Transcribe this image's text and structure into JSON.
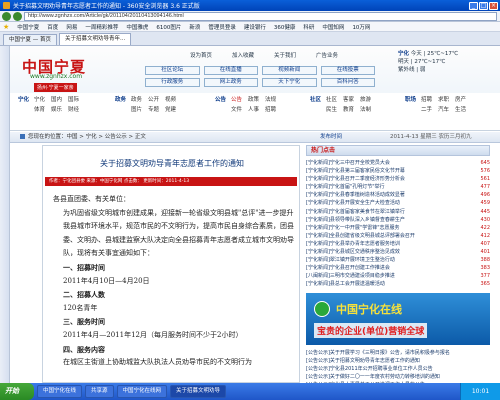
{
  "window": {
    "title": "关于招募文明劝导青年志愿者工作的通知 - 360安全浏览器 3.6 正式版",
    "min": "_",
    "max": "□",
    "close": "×"
  },
  "address": {
    "url": "http://www.zgnhzx.com/Article/gk/201104/20110413094146.html"
  },
  "favorites": {
    "items": [
      "中国宁夏",
      "百度",
      "网易",
      "一周精彩推荐",
      "中国雅虎",
      "6100图片",
      "新浪",
      "管理员登录",
      "建设银行",
      "360健康",
      "科研",
      "中国知网",
      "10万网"
    ]
  },
  "tabs": [
    {
      "label": "中国宁夏 — 首页"
    },
    {
      "label": "关于招募文明劝导青年..."
    }
  ],
  "site": {
    "logo": "中国宁夏",
    "url": "www.zgnhzx.com",
    "slogan": "扬州·宁夏一家亲",
    "toplinks": [
      "设为首页",
      "加入收藏",
      "关于我们",
      "广告业务"
    ],
    "weather_city": "宁化",
    "weather_today": "今天 | 25℃~17℃",
    "weather_tomorrow": "明天 | 27℃~17℃",
    "weather_extra": "紫外线 | 弱",
    "mainnav": [
      "社区论坛",
      "在线直播",
      "视频新闻",
      "在线投票",
      "行政服务",
      "网上政务",
      "天下宁化",
      "百科问答"
    ]
  },
  "subnav": {
    "groups": [
      {
        "label": "宁化",
        "items": [
          "宁化",
          "国内",
          "国际",
          "体育",
          "娱乐",
          "财经"
        ]
      },
      {
        "label": "政务",
        "items": [
          "政务",
          "公开",
          "视频",
          "图片",
          "专题",
          "党建"
        ]
      },
      {
        "label": "公告",
        "items": [
          "公告",
          "政策",
          "法规",
          "文件",
          "人事",
          "招聘"
        ]
      },
      {
        "label": "社区",
        "items": [
          "社区",
          "客家",
          "旅游",
          "民生",
          "教育",
          "法制"
        ]
      },
      {
        "label": "职场",
        "items": [
          "招聘",
          "求职",
          "房产",
          "二手",
          "汽车",
          "生活"
        ]
      }
    ]
  },
  "breadcrumb": {
    "text": "您现在的位置：中国 > 宁化 > 公告公示 > 正文",
    "published": "发布时间",
    "daynote": "2011-4-13 星期三 农历三月初九"
  },
  "article": {
    "title": "关于招募文明劝导青年志愿者工作的通知",
    "meta": "作者：宁化团县委  来源：中国宁化网  点击数：  更新时间：2011-4-13",
    "paragraphs": [
      "各县直团委、有关单位：",
      "为巩固省级文明城市创建成果，迎接新一轮省级文明县城\"总评\"进一步提升我县城市环境水平，规范市民的不文明行为，提高市民自身综合素质，团县委、文明办、县城建监察大队决定向全县招募青年志愿者成立城市文明劝导队，现将有关事宜通知如下：",
      "一、招募时间",
      "2011年4月10日—4月20日",
      "二、招募人数",
      "120名青年",
      "三、服务时间",
      "2011年4月—2011年12月（每月服务时间不少于2小时）",
      "四、服务内容",
      "在城区主街道上协助城监大队执法人员劝导市民的不文明行为"
    ]
  },
  "right": {
    "news_header": "热门点击",
    "news": [
      {
        "title": "[宁化新闻]宁化三中召开全校党员大会",
        "count": "645"
      },
      {
        "title": "[宁化新闻]宁化县第三届客家民俗文化节开幕",
        "count": "576"
      },
      {
        "title": "[宁化新闻]宁化县召开二季度经济形势分析会",
        "count": "561"
      },
      {
        "title": "[宁化新闻]宁化首届\"孔明灯节\"举行",
        "count": "477"
      },
      {
        "title": "[宁化新闻]宁化县春季植树造林活动成效显著",
        "count": "496"
      },
      {
        "title": "[宁化新闻]宁化县开展安全生产大检查活动",
        "count": "459"
      },
      {
        "title": "[宁化新闻]宁化首届客家美食节在翠江镇举行",
        "count": "445"
      },
      {
        "title": "[宁化新闻]县领导带队深入乡镇督查春耕生产",
        "count": "430"
      },
      {
        "title": "[宁化新闻]宁化一中开展\"学雷锋\"志愿服务",
        "count": "422"
      },
      {
        "title": "[宁化新闻]全县创建省级文明县城总评部署会召开",
        "count": "412"
      },
      {
        "title": "[宁化新闻]宁化县举办青年志愿者服务培训",
        "count": "407"
      },
      {
        "title": "[宁化新闻]宁化县城区交通秩序整治见成效",
        "count": "401"
      },
      {
        "title": "[宁化新闻]翠江镇开展环境卫生整治行动",
        "count": "388"
      },
      {
        "title": "[宁化新闻]宁化县召开创建工作推进会",
        "count": "383"
      },
      {
        "title": "[八闽新闻]三明市交通建设项目稳步推进",
        "count": "377"
      },
      {
        "title": "[宁化新闻]县总工会开展送温暖活动",
        "count": "365"
      }
    ],
    "banner_title": "中国宁化在线",
    "banner_sub": "宝贵的企业(单位)营销全球",
    "announcements": [
      "[公告公示]关于开展学习《三明日报》公告，请市民积极参与报名",
      "[公告公示]关于招募文明劝导青年志愿者工作的通知",
      "[公告公示]宁化县2011年公开招聘事业单位工作人员公告",
      "[公告公示]关于做好二〇一一年度农村劳动力转移培训的通知",
      "[公告公示]宁化县人事局关于公开选调工作人员的公告",
      "[公告公示]\"宁化县\"合格证申领登记补充通知",
      "[公告公示]关于宁化县2011年春季征兵工作的通告",
      "[公告公示]宁化县城区道路交通管理通告"
    ]
  },
  "taskbar": {
    "start": "开始",
    "items": [
      "中国宁化在线",
      "共享源",
      "中国宁化在线网",
      "关于招募文明劝导"
    ],
    "time": "10:01"
  }
}
